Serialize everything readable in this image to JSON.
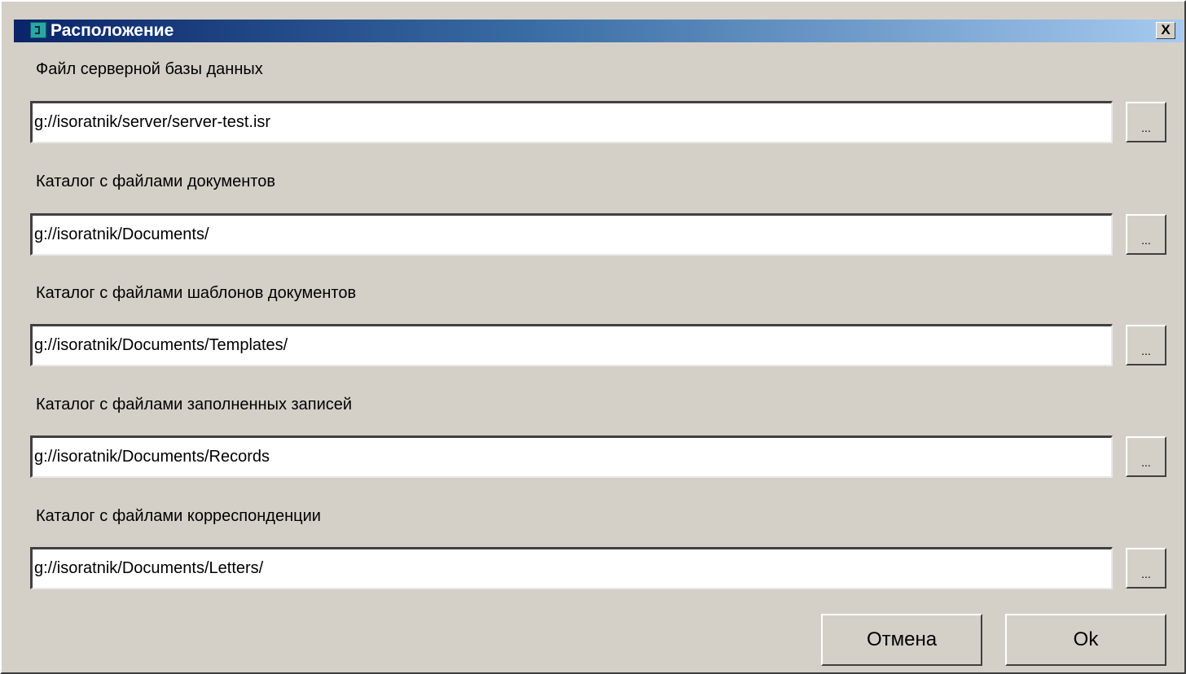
{
  "window": {
    "title": "Расположение",
    "close_label": "X",
    "title_gradient": [
      "#0a246a",
      "#a6caf0"
    ]
  },
  "fields": [
    {
      "label": "Файл  серверной базы данных",
      "value": "g://isoratnik/server/server-test.isr",
      "browse_label": "..."
    },
    {
      "label": "Каталог с файлами документов",
      "value": "g://isoratnik/Documents/",
      "browse_label": "..."
    },
    {
      "label": "Каталог с файлами шаблонов документов",
      "value": "g://isoratnik/Documents/Templates/",
      "browse_label": "..."
    },
    {
      "label": "Каталог с файлами заполненных записей",
      "value": "g://isoratnik/Documents/Records",
      "browse_label": "..."
    },
    {
      "label": "Каталог с файлами корреспонденции",
      "value": "g://isoratnik/Documents/Letters/",
      "browse_label": "..."
    }
  ],
  "buttons": {
    "cancel_label": "Отмена",
    "ok_label": "Ok"
  }
}
